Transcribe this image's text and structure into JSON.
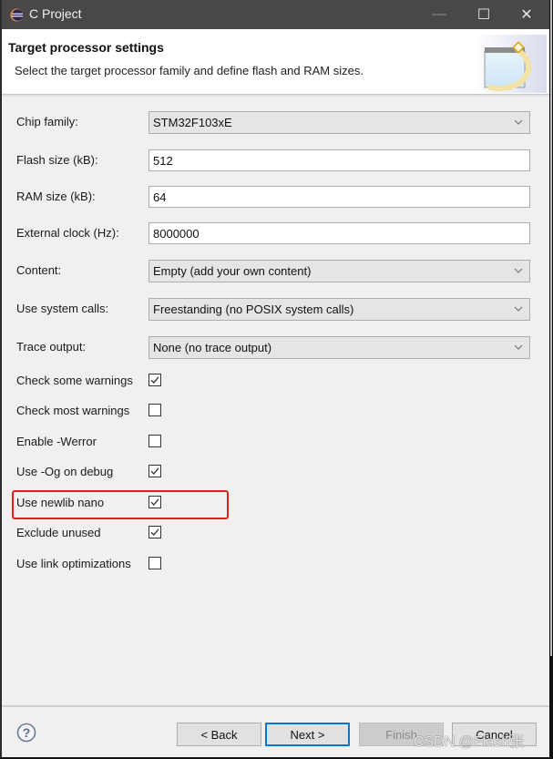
{
  "window": {
    "title": "C Project",
    "controls": {
      "minimize": "—",
      "maximize": "☐",
      "close": "✕"
    }
  },
  "banner": {
    "heading": "Target processor settings",
    "description": "Select the target processor family and define flash and RAM sizes."
  },
  "fields": {
    "chip_family": {
      "label": "Chip family:",
      "value": "STM32F103xE"
    },
    "flash_size": {
      "label": "Flash size (kB):",
      "value": "512"
    },
    "ram_size": {
      "label": "RAM size (kB):",
      "value": "64"
    },
    "external_clock": {
      "label": "External clock (Hz):",
      "value": "8000000"
    },
    "content": {
      "label": "Content:",
      "value": "Empty (add your own content)"
    },
    "system_calls": {
      "label": "Use system calls:",
      "value": "Freestanding (no POSIX system calls)"
    },
    "trace_output": {
      "label": "Trace output:",
      "value": "None (no trace output)"
    }
  },
  "checkboxes": [
    {
      "label": "Check some warnings",
      "checked": true
    },
    {
      "label": "Check most warnings",
      "checked": false
    },
    {
      "label": "Enable -Werror",
      "checked": false
    },
    {
      "label": "Use -Og on debug",
      "checked": true
    },
    {
      "label": "Use newlib nano",
      "checked": true,
      "highlighted": true
    },
    {
      "label": "Exclude unused",
      "checked": true
    },
    {
      "label": "Use link optimizations",
      "checked": false
    }
  ],
  "buttons": {
    "back": "< Back",
    "next": "Next >",
    "finish": "Finish",
    "cancel": "Cancel"
  },
  "colors": {
    "highlight": "#e02020",
    "default_button_border": "#0078d7"
  },
  "watermark": "CSDN @Flash张"
}
